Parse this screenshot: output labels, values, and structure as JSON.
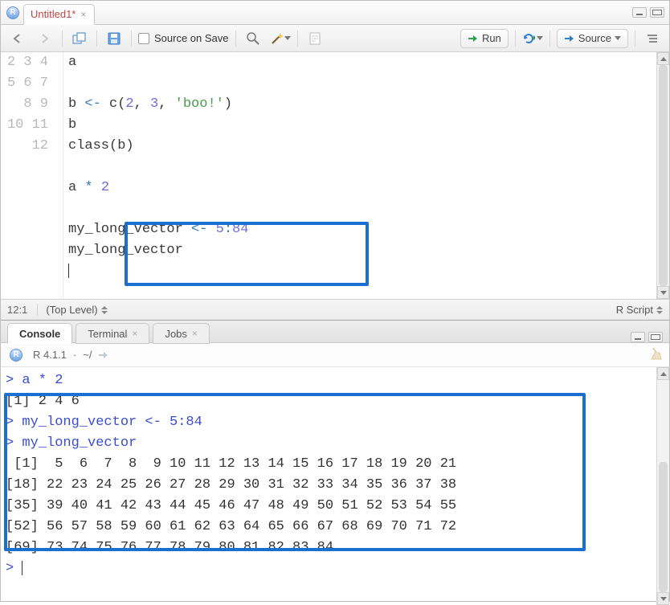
{
  "tab": {
    "title": "Untitled1*"
  },
  "toolbar": {
    "source_on_save": "Source on Save",
    "run": "Run",
    "source": "Source"
  },
  "editor": {
    "gutter": [
      "2",
      "3",
      "4",
      "5",
      "6",
      "7",
      "8",
      "9",
      "10",
      "11",
      "12"
    ],
    "lines": {
      "l2": "a",
      "l3": "",
      "l4_a": "b ",
      "l4_op": "<-",
      "l4_b": " c(",
      "l4_n1": "2",
      "l4_c": ", ",
      "l4_n2": "3",
      "l4_d": ", ",
      "l4_s": "'boo!'",
      "l4_e": ")",
      "l5": "b",
      "l6": "class(b)",
      "l7": "",
      "l8_a": "a ",
      "l8_op": "*",
      "l8_b": " ",
      "l8_n": "2",
      "l9": "",
      "l10_a": "my_long_vector ",
      "l10_op": "<-",
      "l10_b": " ",
      "l10_n1": "5",
      "l10_c": ":",
      "l10_n2": "84",
      "l11": "my_long_vector",
      "l12": ""
    }
  },
  "status": {
    "pos": "12:1",
    "scope": "(Top Level)",
    "lang": "R Script"
  },
  "console_tabs": {
    "console": "Console",
    "terminal": "Terminal",
    "jobs": "Jobs"
  },
  "console_info": {
    "version": "R 4.1.1",
    "sep": "·",
    "cwd": "~/"
  },
  "console": {
    "c1": "> a * 2",
    "c2": "[1] 2 4 6",
    "c3": "> my_long_vector <- 5:84",
    "c4": "> my_long_vector",
    "c5": " [1]  5  6  7  8  9 10 11 12 13 14 15 16 17 18 19 20 21",
    "c6": "[18] 22 23 24 25 26 27 28 29 30 31 32 33 34 35 36 37 38",
    "c7": "[35] 39 40 41 42 43 44 45 46 47 48 49 50 51 52 53 54 55",
    "c8": "[52] 56 57 58 59 60 61 62 63 64 65 66 67 68 69 70 71 72",
    "c9": "[69] 73 74 75 76 77 78 79 80 81 82 83 84",
    "prompt": "> "
  }
}
